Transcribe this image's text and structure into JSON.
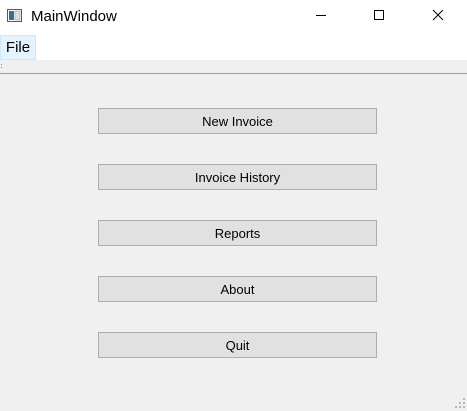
{
  "window": {
    "title": "MainWindow"
  },
  "menubar": {
    "items": [
      {
        "label": "File"
      }
    ]
  },
  "main": {
    "buttons": [
      {
        "label": "New Invoice"
      },
      {
        "label": "Invoice History"
      },
      {
        "label": "Reports"
      },
      {
        "label": "About"
      },
      {
        "label": "Quit"
      }
    ]
  },
  "icons": {
    "app": "app-window-icon",
    "minimize": "minimize-icon",
    "maximize": "maximize-icon",
    "close": "close-icon",
    "size_grip": "size-grip-icon",
    "toolbar_handle": "toolbar-handle-icon"
  },
  "colors": {
    "window_background": "#f0f0f0",
    "button_background": "#e1e1e1",
    "button_border": "#adadad",
    "menu_highlight": "#e5f3ff"
  }
}
